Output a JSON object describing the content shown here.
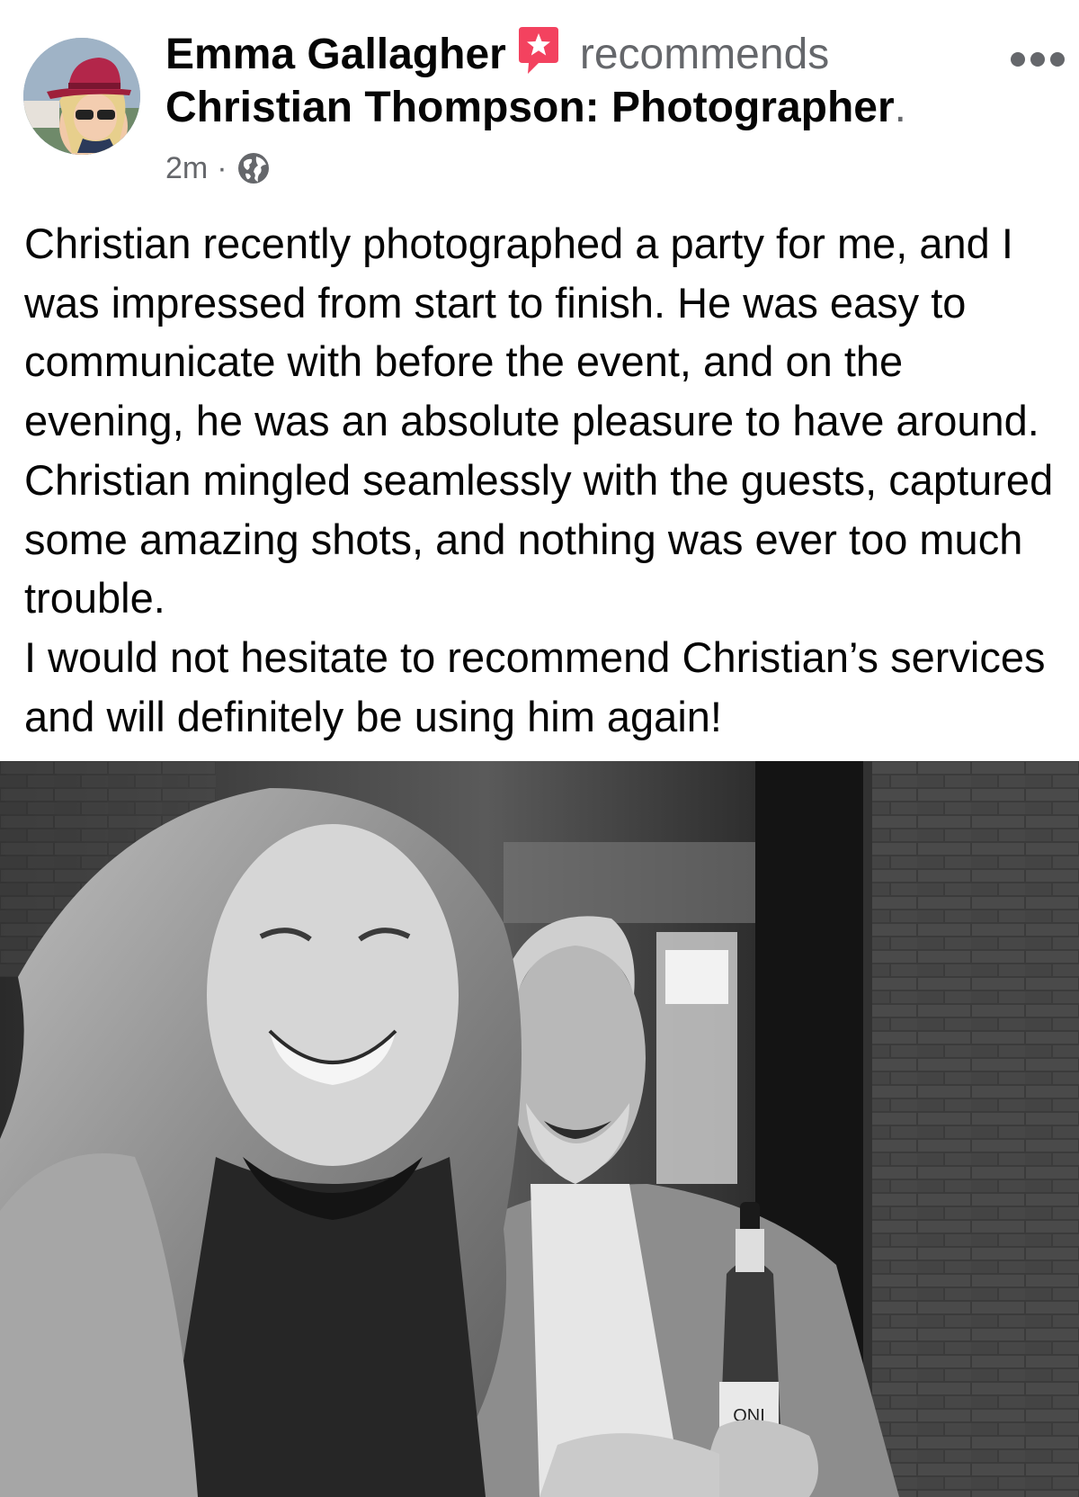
{
  "post": {
    "author_name": "Emma Gallagher",
    "action_text": "recommends",
    "page_name": "Christian Thompson: Photographer",
    "page_suffix": ".",
    "timestamp": "2m",
    "separator": "·",
    "audience_icon": "globe-icon",
    "recommend_icon": "star-badge-icon",
    "more_icon": "more-options-icon",
    "body_paragraphs": [
      "Christian recently photographed a party for me, and I was impressed from start to finish. He was easy to communicate with before the event, and on the evening, he was an absolute pleasure to have around. Christian mingled seamlessly with the guests, captured some amazing shots, and nothing was ever too much trouble.",
      "I would not hesitate to recommend Christian’s services and will definitely be using him again!"
    ],
    "photo": {
      "style": "black-and-white",
      "bottle_label": "ONI"
    }
  },
  "colors": {
    "text_primary": "#050505",
    "text_secondary": "#65676b",
    "recommend_badge": "#f3425f",
    "background": "#ffffff"
  }
}
